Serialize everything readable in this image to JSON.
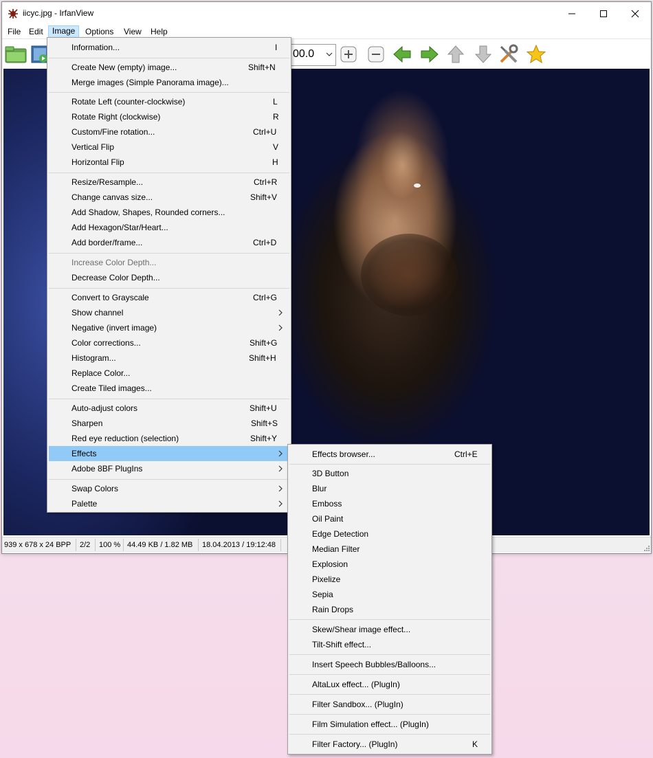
{
  "window": {
    "title": "iicyc.jpg - IrfanView"
  },
  "menubar": [
    "File",
    "Edit",
    "Image",
    "Options",
    "View",
    "Help"
  ],
  "toolbar": {
    "zoom_value": "00.0"
  },
  "statusbar": {
    "dimensions": "939 x 678 x 24 BPP",
    "index": "2/2",
    "zoom": "100 %",
    "size": "44.49 KB / 1.82 MB",
    "datetime": "18.04.2013 / 19:12:48"
  },
  "image_menu": {
    "items": [
      {
        "label": "Information...",
        "shortcut": "I"
      },
      {
        "label": "Create New (empty) image...",
        "shortcut": "Shift+N"
      },
      {
        "label": "Merge images (Simple Panorama image)...",
        "shortcut": ""
      },
      {
        "label": "Rotate Left (counter-clockwise)",
        "shortcut": "L"
      },
      {
        "label": "Rotate Right (clockwise)",
        "shortcut": "R"
      },
      {
        "label": "Custom/Fine rotation...",
        "shortcut": "Ctrl+U"
      },
      {
        "label": "Vertical Flip",
        "shortcut": "V"
      },
      {
        "label": "Horizontal Flip",
        "shortcut": "H"
      },
      {
        "label": "Resize/Resample...",
        "shortcut": "Ctrl+R"
      },
      {
        "label": "Change canvas size...",
        "shortcut": "Shift+V"
      },
      {
        "label": "Add Shadow, Shapes, Rounded corners...",
        "shortcut": ""
      },
      {
        "label": "Add Hexagon/Star/Heart...",
        "shortcut": ""
      },
      {
        "label": "Add border/frame...",
        "shortcut": "Ctrl+D"
      },
      {
        "label": "Increase Color Depth...",
        "shortcut": ""
      },
      {
        "label": "Decrease Color Depth...",
        "shortcut": ""
      },
      {
        "label": "Convert to Grayscale",
        "shortcut": "Ctrl+G"
      },
      {
        "label": "Show channel",
        "shortcut": ""
      },
      {
        "label": "Negative (invert image)",
        "shortcut": ""
      },
      {
        "label": "Color corrections...",
        "shortcut": "Shift+G"
      },
      {
        "label": "Histogram...",
        "shortcut": "Shift+H"
      },
      {
        "label": "Replace Color...",
        "shortcut": ""
      },
      {
        "label": "Create Tiled images...",
        "shortcut": ""
      },
      {
        "label": "Auto-adjust colors",
        "shortcut": "Shift+U"
      },
      {
        "label": "Sharpen",
        "shortcut": "Shift+S"
      },
      {
        "label": "Red eye reduction (selection)",
        "shortcut": "Shift+Y"
      },
      {
        "label": "Effects",
        "shortcut": ""
      },
      {
        "label": "Adobe 8BF PlugIns",
        "shortcut": ""
      },
      {
        "label": "Swap Colors",
        "shortcut": ""
      },
      {
        "label": "Palette",
        "shortcut": ""
      }
    ]
  },
  "effects_menu": {
    "items": [
      {
        "label": "Effects browser...",
        "shortcut": "Ctrl+E"
      },
      {
        "label": "3D Button",
        "shortcut": ""
      },
      {
        "label": "Blur",
        "shortcut": ""
      },
      {
        "label": "Emboss",
        "shortcut": ""
      },
      {
        "label": "Oil Paint",
        "shortcut": ""
      },
      {
        "label": "Edge Detection",
        "shortcut": ""
      },
      {
        "label": "Median Filter",
        "shortcut": ""
      },
      {
        "label": "Explosion",
        "shortcut": ""
      },
      {
        "label": "Pixelize",
        "shortcut": ""
      },
      {
        "label": "Sepia",
        "shortcut": ""
      },
      {
        "label": "Rain Drops",
        "shortcut": ""
      },
      {
        "label": "Skew/Shear image effect...",
        "shortcut": ""
      },
      {
        "label": "Tilt-Shift effect...",
        "shortcut": ""
      },
      {
        "label": "Insert Speech Bubbles/Balloons...",
        "shortcut": ""
      },
      {
        "label": "AltaLux effect... (PlugIn)",
        "shortcut": ""
      },
      {
        "label": "Filter Sandbox... (PlugIn)",
        "shortcut": ""
      },
      {
        "label": "Film Simulation effect... (PlugIn)",
        "shortcut": ""
      },
      {
        "label": "Filter Factory... (PlugIn)",
        "shortcut": "K"
      }
    ]
  },
  "colors": {
    "highlight": "#91c9f7",
    "menubar_active": "#cce8ff",
    "disabled_text": "#6d6d6d"
  }
}
